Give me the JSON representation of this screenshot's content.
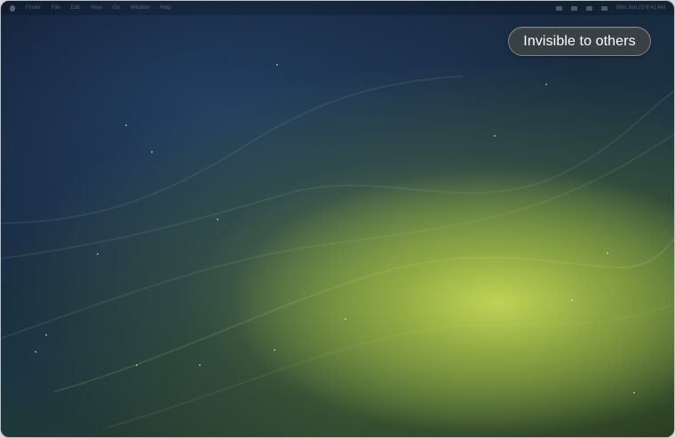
{
  "menubar": {
    "items": [
      "Finder",
      "File",
      "Edit",
      "View",
      "Go",
      "Window",
      "Help"
    ],
    "clock": "Mon Jun 23  9:41 AM"
  },
  "status_pill": {
    "label": "Invisible to others"
  },
  "wallpaper": {
    "colors": {
      "top_left": "#0f1a2e",
      "glow": "#c4d656",
      "mid": "#1c3542"
    }
  }
}
